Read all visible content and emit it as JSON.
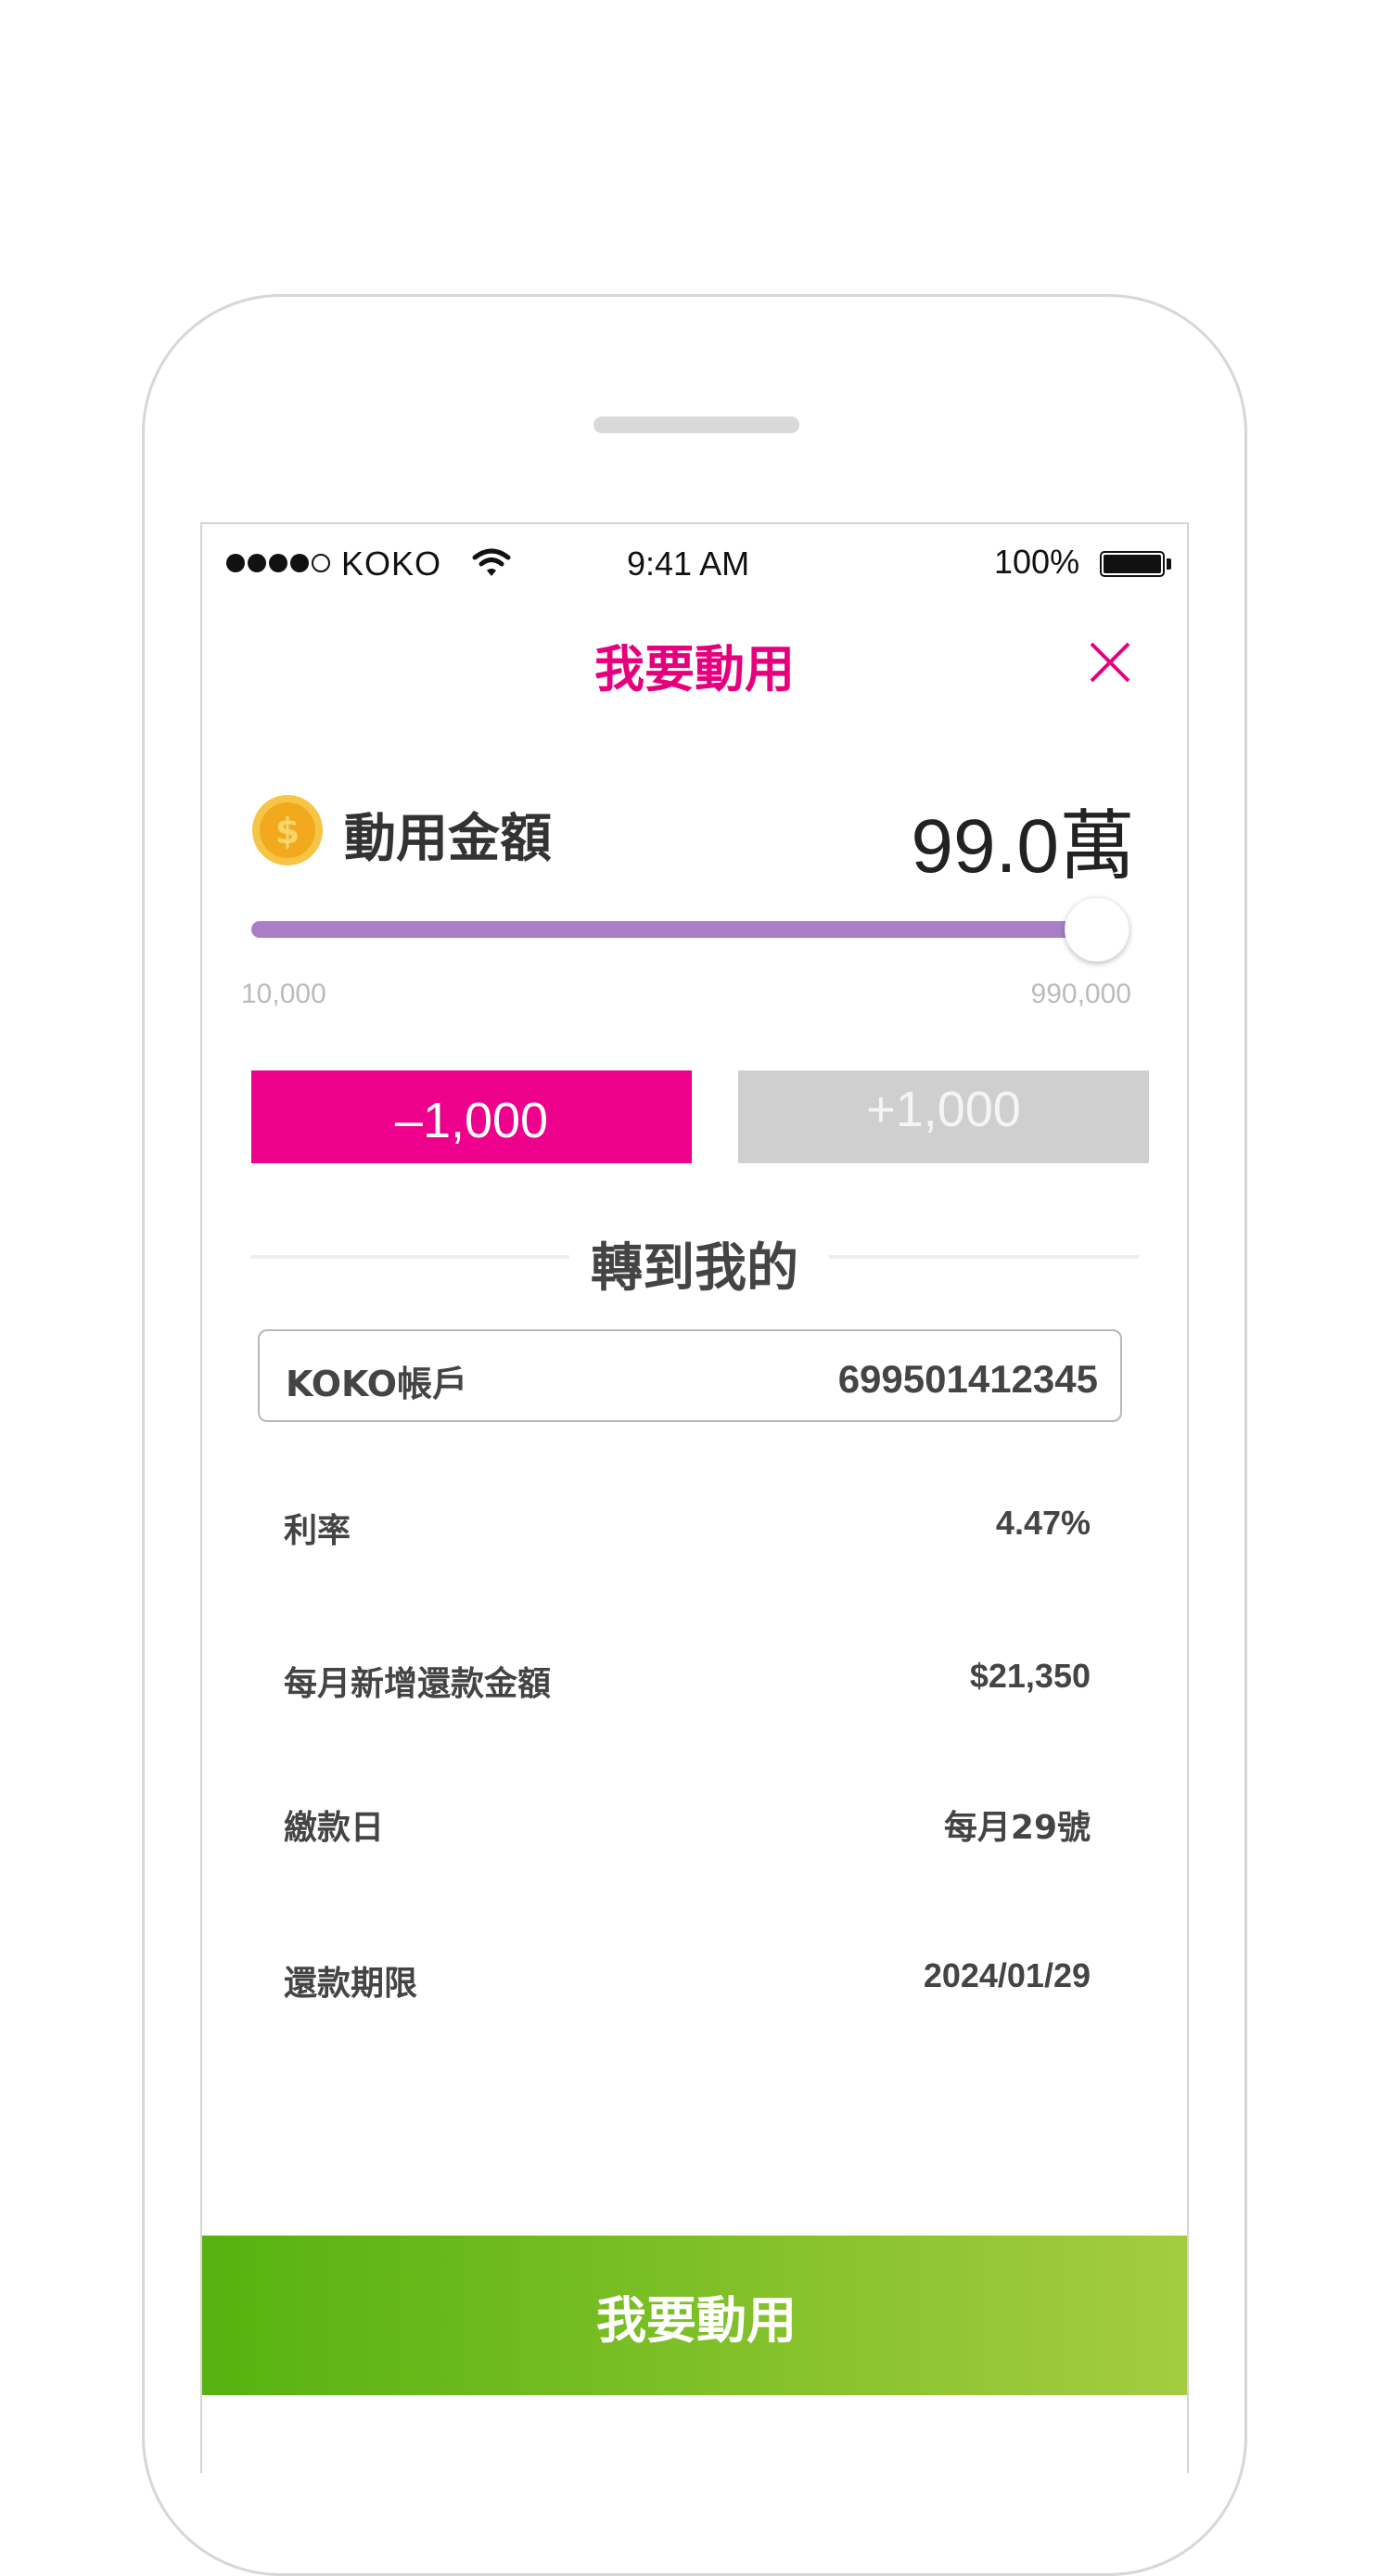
{
  "status_bar": {
    "carrier": "KOKO",
    "time": "9:41 AM",
    "battery": "100%"
  },
  "nav": {
    "title": "我要動用",
    "close_icon": "close-icon"
  },
  "amount": {
    "label": "動用金額",
    "value": "99.0萬",
    "icon": "coin-dollar-icon"
  },
  "slider": {
    "min_label": "10,000",
    "max_label": "990,000",
    "level_fraction": 1.0,
    "color": "#a97ec6"
  },
  "steppers": {
    "minus_label": "–1,000",
    "plus_label": "+1,000",
    "minus_color": "#ec008c",
    "plus_color": "#cfcfcf"
  },
  "transfer": {
    "title": "轉到我的",
    "account_name": "KOKO帳戶",
    "account_number": "699501412345"
  },
  "details": [
    {
      "label": "利率",
      "value": "4.47%"
    },
    {
      "label": "每月新增還款金額",
      "value": "$21,350"
    },
    {
      "label": "繳款日",
      "value": "每月29號"
    },
    {
      "label": "還款期限",
      "value": "2024/01/29"
    }
  ],
  "cta": {
    "label": "我要動用",
    "gradient_start": "#55b20f",
    "gradient_end": "#a5cc42"
  },
  "accent_color": "#e6007e"
}
